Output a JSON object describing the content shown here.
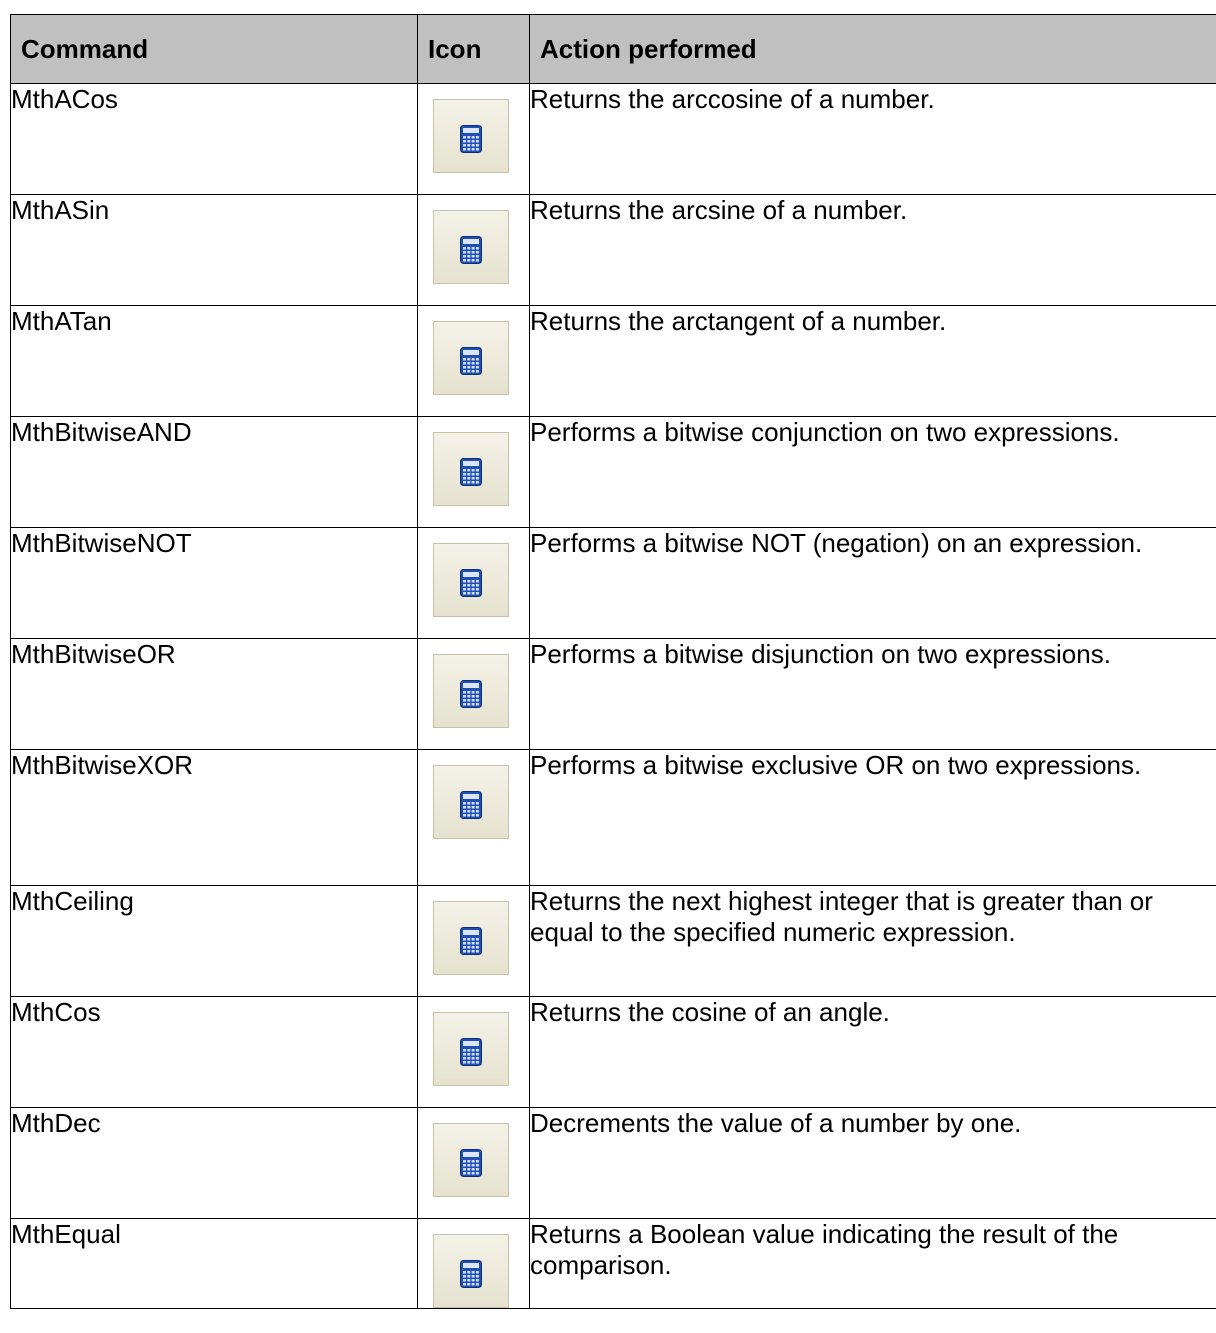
{
  "table": {
    "headers": {
      "command": "Command",
      "icon": "Icon",
      "action": "Action performed"
    },
    "icon_name": "calculator-icon",
    "rows": [
      {
        "command": "MthACos",
        "action": "Returns the arccosine of a number."
      },
      {
        "command": "MthASin",
        "action": "Returns the arcsine of a number."
      },
      {
        "command": "MthATan",
        "action": "Returns the arctangent of a number."
      },
      {
        "command": "MthBitwiseAND",
        "action": "Performs a bitwise conjunction on two expressions."
      },
      {
        "command": "MthBitwiseNOT",
        "action": "Performs a bitwise NOT (negation) on an expression."
      },
      {
        "command": "MthBitwiseOR",
        "action": "Performs a bitwise disjunction on two expressions."
      },
      {
        "command": "MthBitwiseXOR",
        "action": "Performs a bitwise exclusive OR on two expressions."
      },
      {
        "command": "MthCeiling",
        "action": "Returns the next highest integer that is greater than or equal to the specified numeric expression."
      },
      {
        "command": "MthCos",
        "action": "Returns the cosine of an angle."
      },
      {
        "command": "MthDec",
        "action": "Decrements the value of a number by one."
      },
      {
        "command": "MthEqual",
        "action": "Returns a Boolean value indicating the result of the comparison."
      }
    ]
  },
  "colors": {
    "header_bg": "#c0c0c0",
    "border": "#000000",
    "icon_button_bg": "#ece9d8",
    "calculator_blue": "#1f4fb0"
  }
}
